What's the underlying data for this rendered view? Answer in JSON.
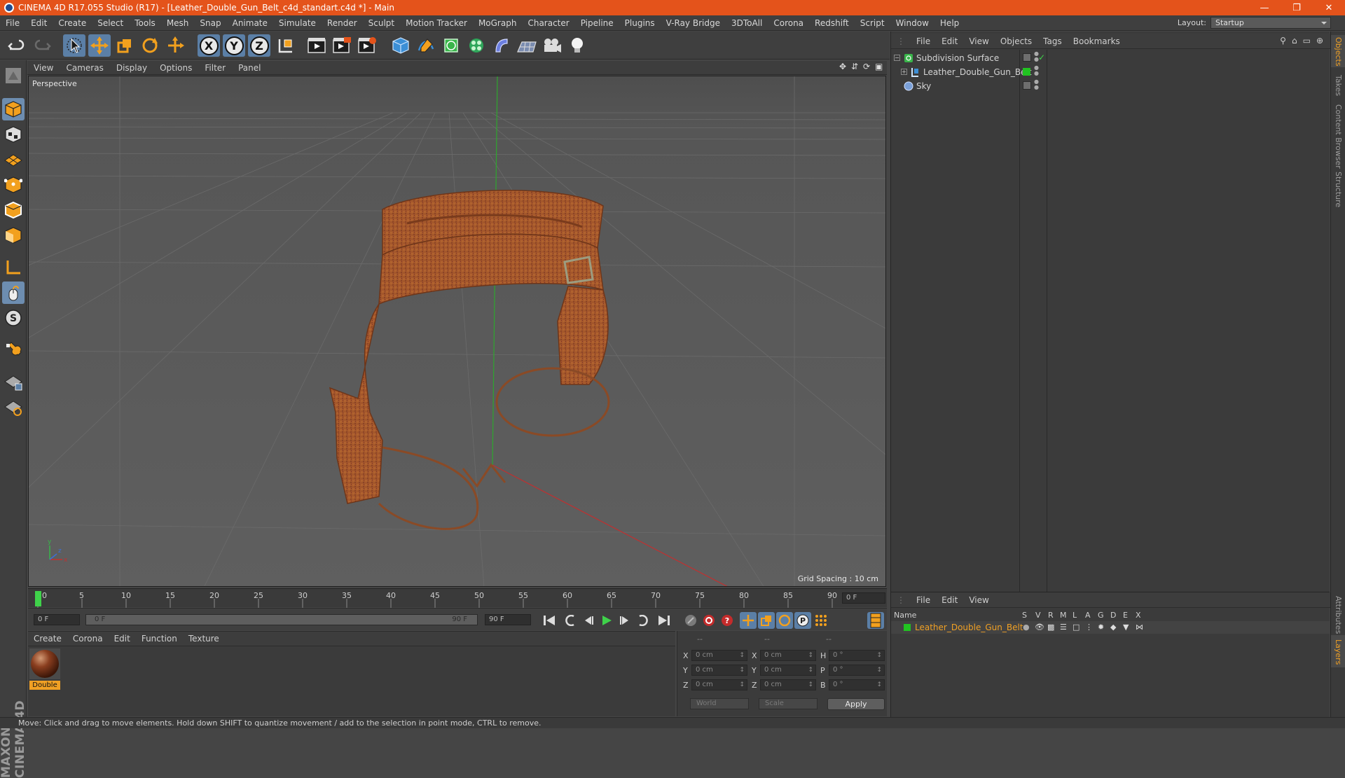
{
  "window": {
    "title": "CINEMA 4D R17.055 Studio (R17) - [Leather_Double_Gun_Belt_c4d_standart.c4d *] - Main"
  },
  "menubar": [
    "File",
    "Edit",
    "Create",
    "Select",
    "Tools",
    "Mesh",
    "Snap",
    "Animate",
    "Simulate",
    "Render",
    "Sculpt",
    "Motion Tracker",
    "MoGraph",
    "Character",
    "Pipeline",
    "Plugins",
    "V-Ray Bridge",
    "3DToAll",
    "Corona",
    "Redshift",
    "Script",
    "Window",
    "Help"
  ],
  "layout": {
    "label": "Layout:",
    "value": "Startup"
  },
  "toolbar": {
    "x_label": "X",
    "y_label": "Y",
    "z_label": "Z"
  },
  "viewport": {
    "menu": [
      "View",
      "Cameras",
      "Display",
      "Options",
      "Filter",
      "Panel"
    ],
    "camera_label": "Perspective",
    "grid_spacing": "Grid Spacing : 10 cm"
  },
  "timeline": {
    "ticks": [
      "0",
      "5",
      "10",
      "15",
      "20",
      "25",
      "30",
      "35",
      "40",
      "45",
      "50",
      "55",
      "60",
      "65",
      "70",
      "75",
      "80",
      "85",
      "90"
    ],
    "current_frame": "0 F",
    "start_field": "0 F",
    "range_start": "0 F",
    "range_end": "90 F",
    "end_field": "90 F"
  },
  "material_manager": {
    "menu": [
      "Create",
      "Corona",
      "Edit",
      "Function",
      "Texture"
    ],
    "materials": [
      {
        "name": "Double"
      }
    ]
  },
  "coordinates": {
    "headers": [
      "--",
      "--",
      "--"
    ],
    "rows": [
      {
        "a": "X",
        "a_val": "0 cm",
        "b": "X",
        "b_val": "0 cm",
        "c": "H",
        "c_val": "0 °"
      },
      {
        "a": "Y",
        "a_val": "0 cm",
        "b": "Y",
        "b_val": "0 cm",
        "c": "P",
        "c_val": "0 °"
      },
      {
        "a": "Z",
        "a_val": "0 cm",
        "b": "Z",
        "b_val": "0 cm",
        "c": "B",
        "c_val": "0 °"
      }
    ],
    "space_select": "World",
    "mode_select": "Scale",
    "apply_label": "Apply"
  },
  "object_manager": {
    "menu": [
      "File",
      "Edit",
      "View",
      "Objects",
      "Tags",
      "Bookmarks"
    ],
    "objects": [
      {
        "name": "Subdivision Surface",
        "indent": 0
      },
      {
        "name": "Leather_Double_Gun_Belt",
        "indent": 1
      },
      {
        "name": "Sky",
        "indent": 0
      }
    ]
  },
  "side_tabs": [
    "Objects",
    "Takes",
    "Content Browser",
    "Structure"
  ],
  "side_tabs_bottom": [
    "Attributes",
    "Layers"
  ],
  "layer_manager": {
    "menu": [
      "File",
      "Edit",
      "View"
    ],
    "columns": [
      "Name",
      "S",
      "V",
      "R",
      "M",
      "L",
      "A",
      "G",
      "D",
      "E",
      "X"
    ],
    "layers": [
      {
        "name": "Leather_Double_Gun_Belt",
        "color": "#21c321"
      }
    ]
  },
  "brand": {
    "text": "MAXON CINEMA 4D"
  },
  "status": {
    "text": "Move: Click and drag to move elements. Hold down SHIFT to quantize movement / add to the selection in point mode, CTRL to remove."
  },
  "colors": {
    "title_bar": "#e4531b",
    "selection": "#5b7fa6",
    "active_object": "#f0a024"
  }
}
